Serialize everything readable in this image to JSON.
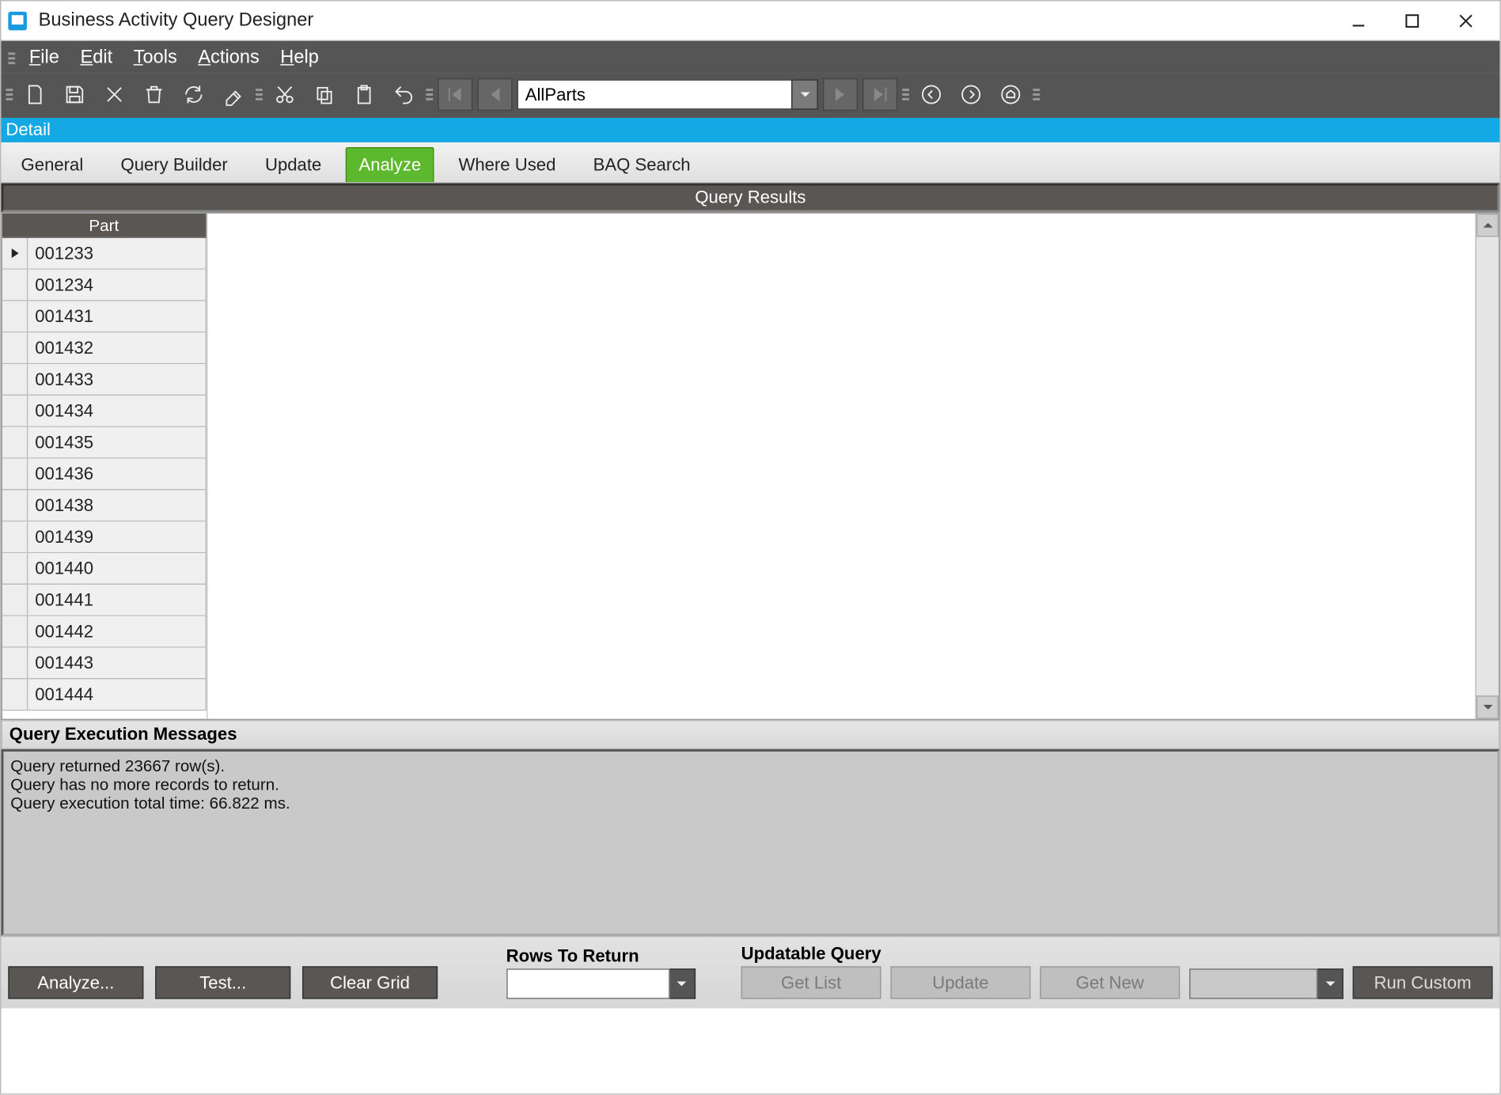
{
  "window": {
    "title": "Business Activity Query Designer"
  },
  "menu": {
    "file": "File",
    "edit": "Edit",
    "tools": "Tools",
    "actions": "Actions",
    "help": "Help"
  },
  "toolbar": {
    "combo_value": "AllParts"
  },
  "detail_strip": "Detail",
  "tabs": {
    "general": "General",
    "query_builder": "Query Builder",
    "update": "Update",
    "analyze": "Analyze",
    "where_used": "Where Used",
    "baq_search": "BAQ Search"
  },
  "results": {
    "header": "Query Results",
    "column": "Part",
    "rows": [
      "001233",
      "001234",
      "001431",
      "001432",
      "001433",
      "001434",
      "001435",
      "001436",
      "001438",
      "001439",
      "001440",
      "001441",
      "001442",
      "001443",
      "001444"
    ]
  },
  "messages": {
    "title": "Query Execution Messages",
    "body": "Query returned 23667 row(s).\nQuery has no more records to return.\nQuery execution total time: 66.822 ms."
  },
  "bottom": {
    "analyze": "Analyze...",
    "test": "Test...",
    "clear_grid": "Clear Grid",
    "rows_to_return_label": "Rows To Return",
    "rows_to_return_value": "",
    "updatable_label": "Updatable Query",
    "get_list": "Get List",
    "update": "Update",
    "get_new": "Get New",
    "combo_value": "",
    "run_custom": "Run Custom"
  }
}
